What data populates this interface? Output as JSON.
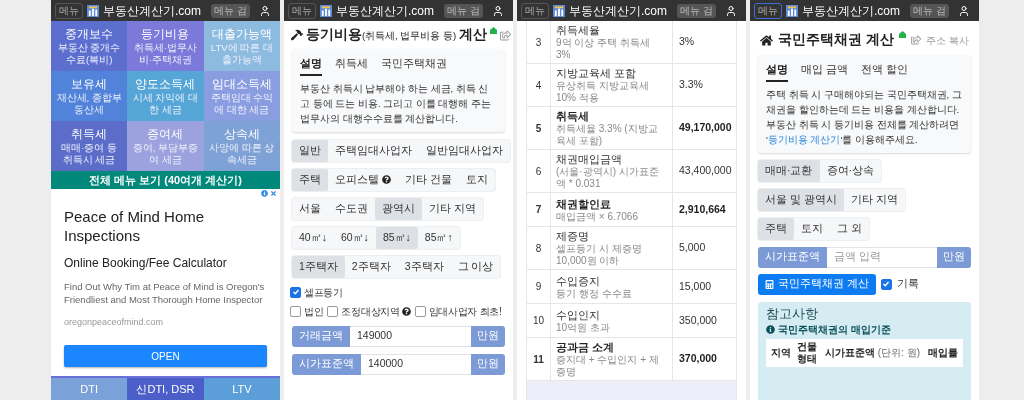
{
  "panels": [
    {
      "kind": "menu",
      "header": {
        "menu": "메뉴",
        "site": "부동산계산기.com",
        "search": "메뉴 검",
        "menu_focused": false
      },
      "tiles": [
        {
          "title": "중개보수",
          "desc": "부동산 중개수수료(복비)",
          "color": "#5c6fcf"
        },
        {
          "title": "등기비용",
          "desc": "취득세·법무사비·주택채권",
          "color": "#7b79d9"
        },
        {
          "title": "대출가능액",
          "desc": "LTV에 따른 대출가능액",
          "color": "#8dbbe0"
        },
        {
          "title": "보유세",
          "desc": "재산세, 종합부동산세",
          "color": "#5083d9"
        },
        {
          "title": "양도소득세",
          "desc": "시세 차익에 대한 세금",
          "color": "#55a6d6"
        },
        {
          "title": "임대소득세",
          "desc": "주택임대 수익에 대한 세금",
          "color": "#8b9de1"
        },
        {
          "title": "취득세",
          "desc": "매매·증여 등 취득시 세금",
          "color": "#5b6cc9"
        },
        {
          "title": "증여세",
          "desc": "증여, 부담부증여 세금",
          "color": "#9ba2de"
        },
        {
          "title": "상속세",
          "desc": "사망에 따른 상속세금",
          "color": "#7fa2d6"
        }
      ],
      "all_menu": "전체 메뉴 보기 (40여개 계산기)",
      "ad": {
        "title": "Peace of Mind Home Inspections",
        "subtitle": "Online Booking/Fee Calculator",
        "text": "Find Out Why Tim at Peace of Mind is Oregon's Friendliest and Most Thorough Home Inspector",
        "url": "oregonpeaceofmind.com",
        "button": "OPEN"
      },
      "bottom_tabs": [
        {
          "label": "DTI",
          "selected": false
        },
        {
          "label": "신DTI, DSR",
          "selected": true
        },
        {
          "label": "LTV",
          "selected": false
        }
      ]
    },
    {
      "kind": "registration",
      "header": {
        "menu": "메뉴",
        "site": "부동산계산기.com",
        "search": "메뉴 검",
        "menu_focused": false
      },
      "title": "**등기비용**(취득세, 법무비용 등) **계산**",
      "info": {
        "tabs": [
          {
            "label": "설명",
            "selected": true
          },
          {
            "label": "취득세",
            "selected": false
          },
          {
            "label": "국민주택채권",
            "selected": false
          }
        ],
        "text": "부동산 취득시 납부해야 하는 세금, 취득 신고 등에 드는 비용. 그리고 이를 대행해 주는 법무사의 대행수수료를 계산합니다."
      },
      "groups": [
        [
          {
            "label": "일반",
            "selected": true,
            "help": false
          },
          {
            "label": "주택임대사업자",
            "selected": false,
            "help": false
          },
          {
            "label": "일반임대사업자",
            "selected": false,
            "help": false
          }
        ],
        [
          {
            "label": "주택",
            "selected": true,
            "help": false
          },
          {
            "label": "오피스텔",
            "selected": false,
            "help": true
          },
          {
            "label": "기타 건물",
            "selected": false,
            "help": false
          },
          {
            "label": "토지",
            "selected": false,
            "help": false
          }
        ],
        [
          {
            "label": "서울",
            "selected": false,
            "help": false
          },
          {
            "label": "수도권",
            "selected": false,
            "help": false
          },
          {
            "label": "광역시",
            "selected": true,
            "help": false
          },
          {
            "label": "기타 지역",
            "selected": false,
            "help": false
          }
        ],
        [
          {
            "label": "40㎡↓",
            "selected": false,
            "help": false
          },
          {
            "label": "60㎡↓",
            "selected": false,
            "help": false
          },
          {
            "label": "85㎡↓",
            "selected": true,
            "help": false
          },
          {
            "label": "85㎡↑",
            "selected": false,
            "help": false
          }
        ],
        [
          {
            "label": "1주택자",
            "selected": true,
            "help": false
          },
          {
            "label": "2주택자",
            "selected": false,
            "help": false
          },
          {
            "label": "3주택자",
            "selected": false,
            "help": false
          },
          {
            "label": "그 이상",
            "selected": false,
            "help": false
          }
        ]
      ],
      "check_rows": [
        [
          {
            "label": "셀프등기",
            "checked": true,
            "help": false
          }
        ],
        [
          {
            "label": "법인",
            "checked": false,
            "help": false
          },
          {
            "label": "조정대상지역",
            "checked": false,
            "help": true
          },
          {
            "label": "임대사업자 최초!",
            "checked": false,
            "help": false
          }
        ]
      ],
      "inputs": [
        {
          "label": "거래금액",
          "value": "149000",
          "unit": "만원"
        },
        {
          "label": "시가표준액",
          "value": "140000",
          "unit": "만원"
        }
      ]
    },
    {
      "kind": "table",
      "header": {
        "menu": "메뉴",
        "site": "부동산계산기.com",
        "search": "메뉴 검",
        "menu_focused": false
      },
      "rows": [
        {
          "no": "3",
          "label": "취득세율",
          "note": "9억 이상 주택 취득세 3%",
          "value": "3%",
          "bold": false
        },
        {
          "no": "4",
          "label": "지방교육세 포함",
          "note": "유상취득 지방교육세 10% 적용",
          "value": "3.3%",
          "bold": false
        },
        {
          "no": "5",
          "label": "취득세",
          "note": "취득세율 3.3% (지방교육세 포함)",
          "value": "49,170,000",
          "bold": true
        },
        {
          "no": "6",
          "label": "채권매입금액",
          "note": "(서울·광역시) 시가표준액 * 0.031",
          "value": "43,400,000",
          "bold": false
        },
        {
          "no": "7",
          "label": "채권할인료",
          "note": "매입금액 × 6.7066",
          "value": "2,910,664",
          "bold": true
        },
        {
          "no": "8",
          "label": "제증명",
          "note": "셀프등기 시 제증명 10,000원 이하",
          "value": "5,000",
          "bold": false
        },
        {
          "no": "9",
          "label": "수입증지",
          "note": "등기 행정 수수료",
          "value": "15,000",
          "bold": false
        },
        {
          "no": "10",
          "label": "수입인지",
          "note": "10억원 초과",
          "value": "350,000",
          "bold": false
        },
        {
          "no": "11",
          "label": "공과금 소계",
          "note": "증지대 + 수입인지 + 제증명",
          "value": "370,000",
          "bold": true
        }
      ]
    },
    {
      "kind": "bond",
      "header": {
        "menu": "메뉴",
        "site": "부동산계산기.com",
        "search": "메뉴 검",
        "menu_focused": true
      },
      "title": "국민주택채권 계산",
      "share": "주소 복사",
      "info": {
        "tabs": [
          {
            "label": "설명",
            "selected": true
          },
          {
            "label": "매입 금액",
            "selected": false
          },
          {
            "label": "전액 할인",
            "selected": false
          }
        ],
        "text": "주택 취득 시 구매해야되는 국민주택채권, 그 채권을 할인하는데 드는 비용을 계산합니다.",
        "link_before": "부동산 취득 시 등기비용 전체를 계산하려면 '",
        "link": "등기비용 계산기",
        "link_after": "'를 이용해주세요."
      },
      "groups": [
        [
          {
            "label": "매매·교환",
            "selected": true,
            "help": false
          },
          {
            "label": "증여·상속",
            "selected": false,
            "help": false
          }
        ],
        [
          {
            "label": "서울 및 광역시",
            "selected": true,
            "help": false
          },
          {
            "label": "기타 지역",
            "selected": false,
            "help": false
          }
        ],
        [
          {
            "label": "주택",
            "selected": true,
            "help": false
          },
          {
            "label": "토지",
            "selected": false,
            "help": false
          },
          {
            "label": "그 외",
            "selected": false,
            "help": false
          }
        ]
      ],
      "input": {
        "label": "시가표준액",
        "placeholder": "금액 입력",
        "unit": "만원"
      },
      "button": "국민주택채권 계산",
      "record": {
        "label": "기록",
        "checked": true
      },
      "reference": {
        "title": "참고사항",
        "subtitle": "국민주택채권의 매입기준",
        "columns": [
          "지역",
          "건물 형태",
          "시가표준액",
          "매입률"
        ],
        "unit_note": "(단위: 원)"
      }
    }
  ]
}
